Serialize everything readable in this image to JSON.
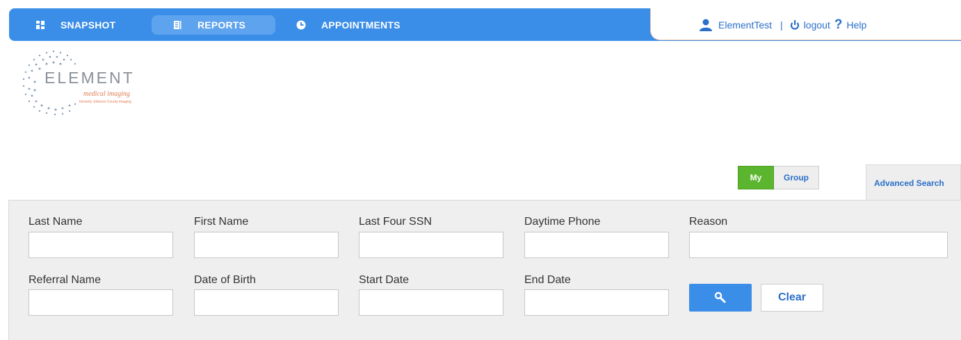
{
  "nav": {
    "items": [
      {
        "label": "SNAPSHOT",
        "icon": "dashboard-icon",
        "active": false
      },
      {
        "label": "REPORTS",
        "icon": "document-icon",
        "active": true
      },
      {
        "label": "APPOINTMENTS",
        "icon": "clock-icon",
        "active": false
      }
    ],
    "color": "#3b8ee8"
  },
  "user": {
    "name": "ElementTest",
    "separator": "|",
    "logout_label": "logout",
    "help_label": "Help",
    "help_glyph": "?"
  },
  "logo": {
    "word": "ELEMENT",
    "subtitle": "medical imaging",
    "tagline": "formerly Johnson County Imaging"
  },
  "tabs": {
    "my": "My",
    "group": "Group",
    "advanced": "Advanced Search"
  },
  "form": {
    "last_name": "Last Name",
    "first_name": "First Name",
    "last_four_ssn": "Last Four SSN",
    "daytime_phone": "Daytime Phone",
    "reason": "Reason",
    "referral_name": "Referral Name",
    "date_of_birth": "Date of Birth",
    "start_date": "Start Date",
    "end_date": "End Date",
    "clear_label": "Clear"
  },
  "colors": {
    "primary": "#3b8ee8",
    "active_tab": "#5cb52e",
    "link": "#2a6fc9",
    "accent": "#e07a50"
  }
}
